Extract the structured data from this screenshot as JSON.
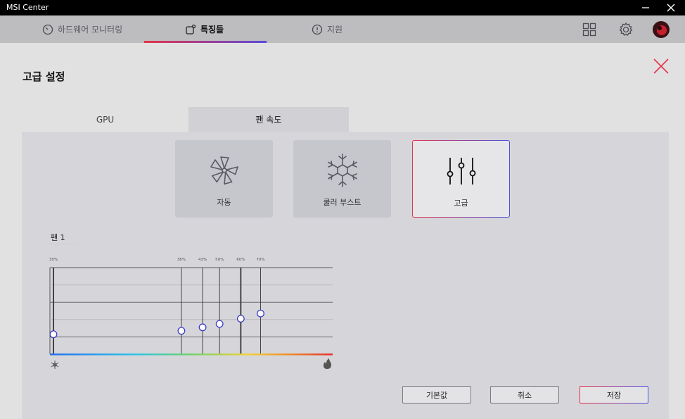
{
  "window": {
    "title": "MSI Center",
    "minimize_icon": "minimize-icon",
    "close_icon": "close-icon"
  },
  "nav": {
    "tabs": [
      {
        "label": "하드웨어 모니터링",
        "icon": "gauge-icon",
        "active": false
      },
      {
        "label": "특징들",
        "icon": "features-icon",
        "active": true
      },
      {
        "label": "지원",
        "icon": "info-icon",
        "active": false
      }
    ],
    "right_icons": [
      "grid-icon",
      "gear-icon",
      "avatar"
    ],
    "accent_gradient": [
      "#e5324a",
      "#5b4bd8"
    ]
  },
  "panel": {
    "title": "고급 설정",
    "tabs": [
      {
        "label": "GPU",
        "active": false
      },
      {
        "label": "팬 속도",
        "active": true
      }
    ],
    "modes": [
      {
        "label": "자동",
        "icon": "fan-icon",
        "selected": false
      },
      {
        "label": "쿨러 부스트",
        "icon": "snowflake-icon",
        "selected": false
      },
      {
        "label": "고급",
        "icon": "sliders-icon",
        "selected": true
      }
    ],
    "fan_label": "팬 1"
  },
  "chart_data": {
    "type": "line",
    "title": "",
    "xlabel": "",
    "ylabel": "",
    "x_label_points": [
      "30%",
      "36%",
      "43%",
      "50%",
      "60%",
      "70%"
    ],
    "x": [
      0,
      0.465,
      0.54,
      0.6,
      0.675,
      0.745
    ],
    "y": [
      0.23,
      0.27,
      0.31,
      0.35,
      0.41,
      0.47
    ],
    "x_axis_icons": {
      "left": "snowflake-icon",
      "right": "flame-icon"
    },
    "grid": true
  },
  "buttons": {
    "default": "기본값",
    "cancel": "취소",
    "save": "저장"
  }
}
